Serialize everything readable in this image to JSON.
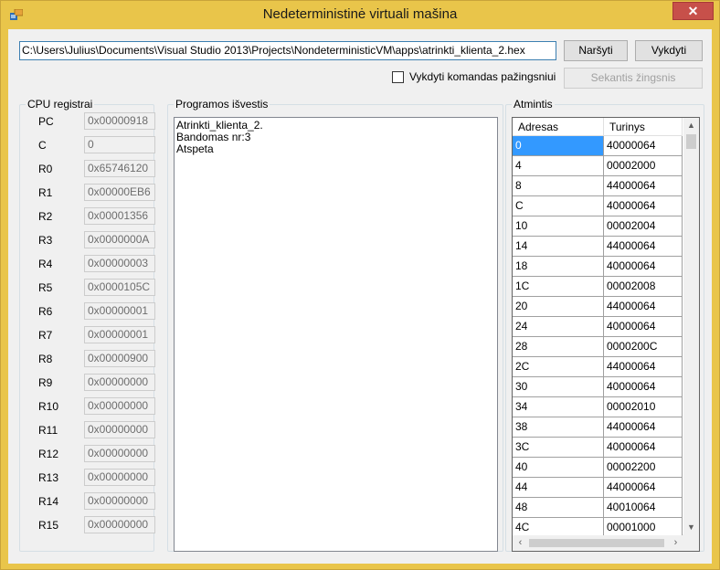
{
  "window": {
    "title": "Nedeterministinė virtuali mašina",
    "close_label": "✕"
  },
  "toolbar": {
    "file_path": "C:\\Users\\Julius\\Documents\\Visual Studio 2013\\Projects\\NondeterministicVM\\apps\\atrinkti_klienta_2.hex",
    "browse_label": "Naršyti",
    "run_label": "Vykdyti",
    "step_mode_label": "Vykdyti komandas pažingsniui",
    "step_mode_checked": false,
    "next_step_label": "Sekantis žingsnis"
  },
  "cpu": {
    "title": "CPU registrai",
    "registers": [
      {
        "name": "PC",
        "value": "0x00000918"
      },
      {
        "name": "C",
        "value": "0"
      },
      {
        "name": "R0",
        "value": "0x65746120"
      },
      {
        "name": "R1",
        "value": "0x00000EB6"
      },
      {
        "name": "R2",
        "value": "0x00001356"
      },
      {
        "name": "R3",
        "value": "0x0000000A"
      },
      {
        "name": "R4",
        "value": "0x00000003"
      },
      {
        "name": "R5",
        "value": "0x0000105C"
      },
      {
        "name": "R6",
        "value": "0x00000001"
      },
      {
        "name": "R7",
        "value": "0x00000001"
      },
      {
        "name": "R8",
        "value": "0x00000900"
      },
      {
        "name": "R9",
        "value": "0x00000000"
      },
      {
        "name": "R10",
        "value": "0x00000000"
      },
      {
        "name": "R11",
        "value": "0x00000000"
      },
      {
        "name": "R12",
        "value": "0x00000000"
      },
      {
        "name": "R13",
        "value": "0x00000000"
      },
      {
        "name": "R14",
        "value": "0x00000000"
      },
      {
        "name": "R15",
        "value": "0x00000000"
      }
    ]
  },
  "output": {
    "title": "Programos išvestis",
    "lines": [
      "Atrinkti_klienta_2.",
      "Bandomas nr:3",
      "Atspeta"
    ]
  },
  "memory": {
    "title": "Atmintis",
    "columns": [
      "Adresas",
      "Turinys"
    ],
    "rows": [
      {
        "address": "0",
        "content": "40000064",
        "selected": true
      },
      {
        "address": "4",
        "content": "00002000"
      },
      {
        "address": "8",
        "content": "44000064"
      },
      {
        "address": "C",
        "content": "40000064"
      },
      {
        "address": "10",
        "content": "00002004"
      },
      {
        "address": "14",
        "content": "44000064"
      },
      {
        "address": "18",
        "content": "40000064"
      },
      {
        "address": "1C",
        "content": "00002008"
      },
      {
        "address": "20",
        "content": "44000064"
      },
      {
        "address": "24",
        "content": "40000064"
      },
      {
        "address": "28",
        "content": "0000200C"
      },
      {
        "address": "2C",
        "content": "44000064"
      },
      {
        "address": "30",
        "content": "40000064"
      },
      {
        "address": "34",
        "content": "00002010"
      },
      {
        "address": "38",
        "content": "44000064"
      },
      {
        "address": "3C",
        "content": "40000064"
      },
      {
        "address": "40",
        "content": "00002200"
      },
      {
        "address": "44",
        "content": "44000064"
      },
      {
        "address": "48",
        "content": "40010064"
      },
      {
        "address": "4C",
        "content": "00001000"
      }
    ]
  }
}
